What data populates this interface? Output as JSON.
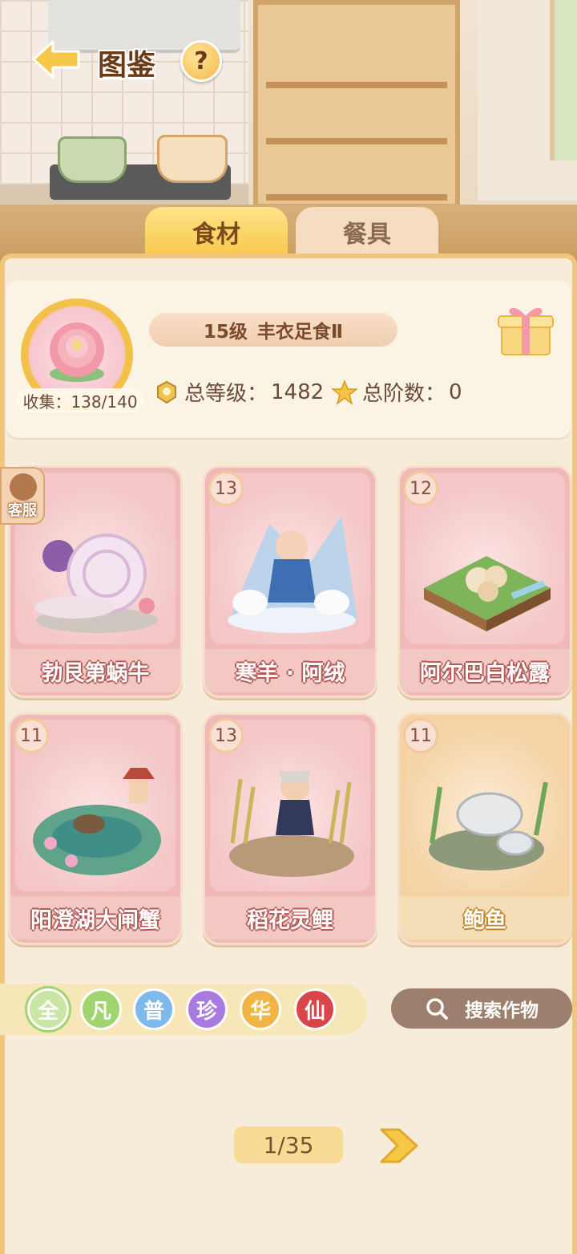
{
  "header": {
    "title": "图鉴",
    "help_label": "?"
  },
  "tabs": [
    {
      "label": "食材",
      "active": true
    },
    {
      "label": "餐具",
      "active": false
    }
  ],
  "profile": {
    "collect_label": "收集：138/140",
    "level": "15级",
    "level_title": "丰衣足食Ⅱ",
    "total_level_label": "总等级：",
    "total_level_value": "1482",
    "total_stage_label": "总阶数：",
    "total_stage_value": "0"
  },
  "service": {
    "label": "客服"
  },
  "items": [
    {
      "level": "",
      "name": "勃艮第蜗牛",
      "theme": "pink"
    },
    {
      "level": "13",
      "name": "寒羊 · 阿绒",
      "theme": "pink"
    },
    {
      "level": "12",
      "name": "阿尔巴白松露",
      "theme": "pink"
    },
    {
      "level": "11",
      "name": "阳澄湖大闸蟹",
      "theme": "pink"
    },
    {
      "level": "13",
      "name": "稻花灵鲤",
      "theme": "pink"
    },
    {
      "level": "11",
      "name": "鲍鱼",
      "theme": "gold"
    }
  ],
  "rarity_filters": [
    {
      "label": "全",
      "color": "#c9e6a4"
    },
    {
      "label": "凡",
      "color": "#9fd46f"
    },
    {
      "label": "普",
      "color": "#7fb8ea"
    },
    {
      "label": "珍",
      "color": "#a77be0"
    },
    {
      "label": "华",
      "color": "#f1b545"
    },
    {
      "label": "仙",
      "color": "#d8454a"
    }
  ],
  "search": {
    "label": "搜索作物"
  },
  "pager": {
    "text": "1/35"
  }
}
